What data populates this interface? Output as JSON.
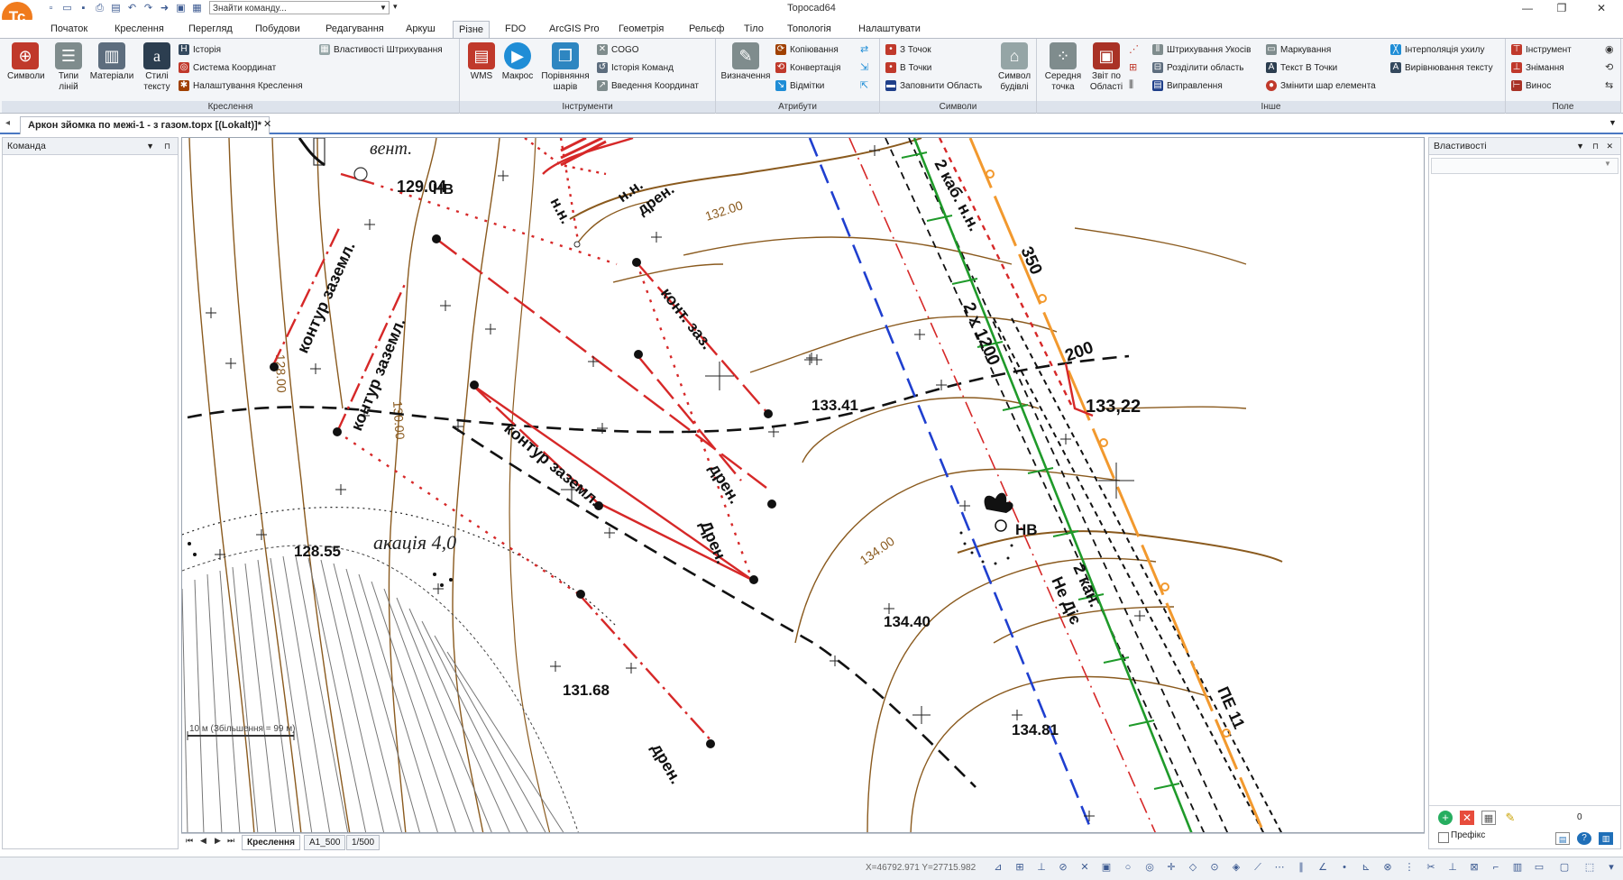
{
  "window": {
    "title": "Topocad64",
    "search_placeholder": "Знайти команду..."
  },
  "quick_access": [
    "new-icon",
    "open-icon",
    "save-icon",
    "print-icon",
    "undo-icon",
    "redo-icon",
    "forward-icon",
    "layers-icon",
    "screen-icon"
  ],
  "ribbon_tabs": [
    {
      "label": "Початок"
    },
    {
      "label": "Креслення"
    },
    {
      "label": "Перегляд"
    },
    {
      "label": "Побудови"
    },
    {
      "label": "Редагування"
    },
    {
      "label": "Аркуш"
    },
    {
      "label": "Різне",
      "active": true
    },
    {
      "label": "FDO"
    },
    {
      "label": "ArcGIS Pro"
    },
    {
      "label": "Геометрія"
    },
    {
      "label": "Рельєф"
    },
    {
      "label": "Тіло"
    },
    {
      "label": "Топологія"
    },
    {
      "label": "Налаштувати"
    }
  ],
  "ribbon_groups": {
    "kreslennia": {
      "label": "Креслення",
      "big": [
        {
          "label": "Символи"
        },
        {
          "label": "Типи ліній",
          "line1": "Типи",
          "line2": "ліній"
        },
        {
          "label": "Матеріали"
        },
        {
          "label": "Стилі тексту",
          "line1": "Стилі",
          "line2": "тексту"
        }
      ],
      "small": [
        {
          "label": "Історія"
        },
        {
          "label": "Система Координат"
        },
        {
          "label": "Налаштування Креслення"
        },
        {
          "label": "Властивості Штрихування"
        }
      ]
    },
    "instrumenty": {
      "label": "Інструменти",
      "big": [
        {
          "label": "WMS"
        },
        {
          "label": "Макрос"
        },
        {
          "label": "Порівняння шарів",
          "line1": "Порівняння",
          "line2": "шарів"
        }
      ],
      "small": [
        {
          "label": "COGO"
        },
        {
          "label": "Історія Команд"
        },
        {
          "label": "Введення Координат"
        }
      ]
    },
    "atrybuty": {
      "label": "Атрибути",
      "big": [
        {
          "label": "Визначення"
        }
      ],
      "small": [
        {
          "label": "Копіювання"
        },
        {
          "label": "Конвертація"
        },
        {
          "label": "Відмітки"
        }
      ]
    },
    "symvoly": {
      "label": "Символи",
      "small": [
        {
          "label": "З Точок"
        },
        {
          "label": "В Точки"
        },
        {
          "label": "Заповнити Область"
        }
      ],
      "big": [
        {
          "label": "Символ будівлі",
          "line1": "Символ",
          "line2": "будівлі"
        }
      ]
    },
    "inshe": {
      "label": "Інше",
      "big": [
        {
          "label": "Середня точка",
          "line1": "Середня",
          "line2": "точка"
        },
        {
          "label": "Звіт по Області",
          "line1": "Звіт по",
          "line2": "Області"
        }
      ],
      "small": [
        {
          "label": "Штрихування Укосів"
        },
        {
          "label": "Розділити область"
        },
        {
          "label": "Виправлення"
        },
        {
          "label": "Маркування"
        },
        {
          "label": "Текст В Точки"
        },
        {
          "label": "Змінити шар елемента"
        },
        {
          "label": "Інтерполяція ухилу"
        },
        {
          "label": "Вирівнювання тексту"
        }
      ]
    },
    "pole": {
      "label": "Поле",
      "small": [
        {
          "label": "Інструмент"
        },
        {
          "label": "Знімання"
        },
        {
          "label": "Винос"
        }
      ]
    }
  },
  "document_tab": {
    "label": "Аркон зйомка по межі-1 - з газом.topx [(Lokalt)]*"
  },
  "left_panel": {
    "title": "Команда"
  },
  "right_panel": {
    "title": "Властивості",
    "checkbox_label": "Префікс",
    "count": "0"
  },
  "map_labels": {
    "t_129": "129.04",
    "t_nv1": "НВ",
    "t_128": "128.00",
    "t_kontur1": "контур заземл.",
    "t_kontur2": "контур заземл.",
    "t_130": "130.00",
    "t_kontur3": "контур заземл.",
    "t_kont_zaz": "конт. заз.",
    "t_nn1": "н.н.",
    "t_nn_dren": "н.н.",
    "t_dren_top": "дрен.",
    "t_132": "132.00",
    "t_13341": "133.41",
    "t_dren1": "дрен.",
    "t_dren2": "Дрен.",
    "t_dren3": "дрен.",
    "t_134": "134.00",
    "t_nv2": "НВ",
    "t_13440": "134.40",
    "t_12855": "128.55",
    "t_akacia": "акація  4,0",
    "t_13168": "131.68",
    "t_13481": "134.81",
    "t_2kab": "2 каб. н.н.",
    "t_350": "350",
    "t_2x1200": "2 х 1200",
    "t_200": "200",
    "t_13322": "133,22",
    "t_2kan": "2 кан.",
    "t_ne_dis": "Не Діє",
    "t_pe": "ПЕ 11",
    "t_vent": "вент.",
    "t_scale": "10 м (Збільшення = 99 м)"
  },
  "layout_tabs": [
    {
      "label": "Креслення",
      "active": true
    },
    {
      "label": "A1_500"
    },
    {
      "label": "1/500"
    }
  ],
  "status": {
    "coords": "X=46792.971 Y=27715.982"
  }
}
